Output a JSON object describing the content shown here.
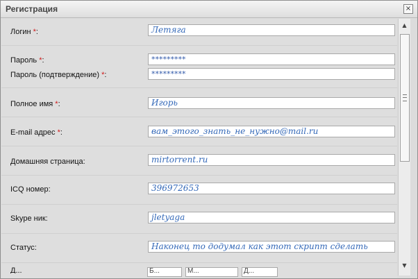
{
  "dialog": {
    "title": "Регистрация",
    "close_symbol": "×",
    "close_icon": "close-icon"
  },
  "fields": [
    {
      "label": "Логин",
      "required": true,
      "value": "Летяга"
    },
    {
      "label": "Пароль",
      "required": true,
      "value": "*********"
    },
    {
      "label": "Пароль (подтверждение)",
      "required": true,
      "value": "*********"
    },
    {
      "label": "Полное имя",
      "required": true,
      "value": "Игорь"
    },
    {
      "label": "E-mail адрес",
      "required": true,
      "value": "вам_этого_знать_не_нужно@mail.ru"
    },
    {
      "label": "Домашняя страница:",
      "required": false,
      "value": "mirtorrent.ru"
    },
    {
      "label": "ICQ номер:",
      "required": false,
      "value": "396972653"
    },
    {
      "label": "Skype ник:",
      "required": false,
      "value": "jletyaga"
    },
    {
      "label": "Статус:",
      "required": false,
      "value": "Наконец то додумал как этот скрипт сделать"
    }
  ],
  "required_marker": "*",
  "label_suffix": ":",
  "partial_row": {
    "label": "Д...",
    "selects": [
      "Б...",
      "М...",
      "Д..."
    ]
  },
  "scrollbar": {
    "up_icon": "arrow-up-icon",
    "down_icon": "arrow-down-icon",
    "thumb_icon": "scroll-thumb-icon"
  }
}
